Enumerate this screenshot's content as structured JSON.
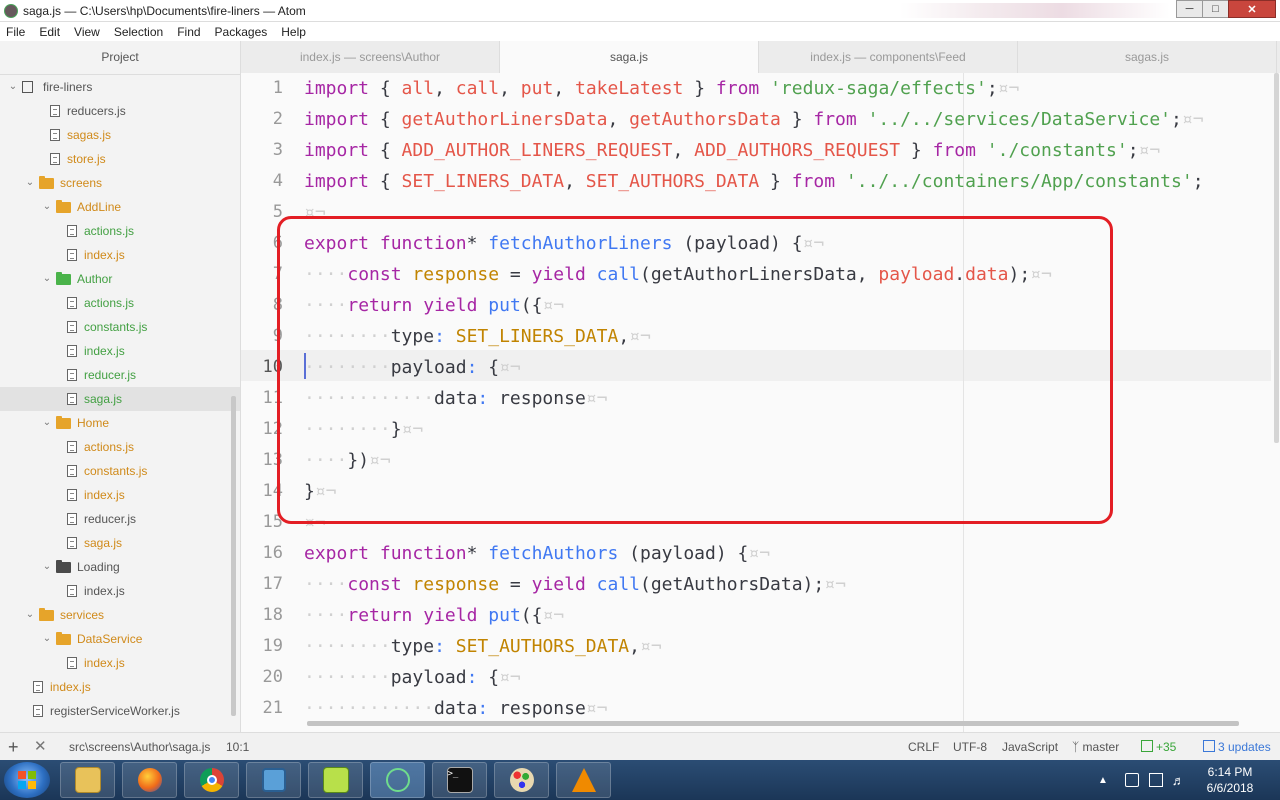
{
  "window": {
    "title": "saga.js — C:\\Users\\hp\\Documents\\fire-liners — Atom"
  },
  "menu": [
    "File",
    "Edit",
    "View",
    "Selection",
    "Find",
    "Packages",
    "Help"
  ],
  "sidebar": {
    "header": "Project",
    "tree": [
      {
        "label": "fire-liners",
        "kind": "repo",
        "depth": 0,
        "expanded": true,
        "color": "gray"
      },
      {
        "label": "reducers.js",
        "kind": "file",
        "depth": 2,
        "color": "gray"
      },
      {
        "label": "sagas.js",
        "kind": "file",
        "depth": 2,
        "color": "orange"
      },
      {
        "label": "store.js",
        "kind": "file",
        "depth": 2,
        "color": "orange"
      },
      {
        "label": "screens",
        "kind": "folder",
        "depth": 1,
        "expanded": true,
        "color": "orange"
      },
      {
        "label": "AddLine",
        "kind": "folder",
        "depth": 2,
        "expanded": true,
        "color": "orange"
      },
      {
        "label": "actions.js",
        "kind": "file",
        "depth": 3,
        "color": "green"
      },
      {
        "label": "index.js",
        "kind": "file",
        "depth": 3,
        "color": "orange"
      },
      {
        "label": "Author",
        "kind": "folder",
        "depth": 2,
        "expanded": true,
        "color": "green"
      },
      {
        "label": "actions.js",
        "kind": "file",
        "depth": 3,
        "color": "green"
      },
      {
        "label": "constants.js",
        "kind": "file",
        "depth": 3,
        "color": "green"
      },
      {
        "label": "index.js",
        "kind": "file",
        "depth": 3,
        "color": "green"
      },
      {
        "label": "reducer.js",
        "kind": "file",
        "depth": 3,
        "color": "green"
      },
      {
        "label": "saga.js",
        "kind": "file",
        "depth": 3,
        "color": "green",
        "selected": true
      },
      {
        "label": "Home",
        "kind": "folder",
        "depth": 2,
        "expanded": true,
        "color": "orange"
      },
      {
        "label": "actions.js",
        "kind": "file",
        "depth": 3,
        "color": "orange"
      },
      {
        "label": "constants.js",
        "kind": "file",
        "depth": 3,
        "color": "orange"
      },
      {
        "label": "index.js",
        "kind": "file",
        "depth": 3,
        "color": "orange"
      },
      {
        "label": "reducer.js",
        "kind": "file",
        "depth": 3,
        "color": "gray"
      },
      {
        "label": "saga.js",
        "kind": "file",
        "depth": 3,
        "color": "orange"
      },
      {
        "label": "Loading",
        "kind": "folder",
        "depth": 2,
        "expanded": true,
        "color": "gray"
      },
      {
        "label": "index.js",
        "kind": "file",
        "depth": 3,
        "color": "gray"
      },
      {
        "label": "services",
        "kind": "folder",
        "depth": 1,
        "expanded": true,
        "color": "orange"
      },
      {
        "label": "DataService",
        "kind": "folder",
        "depth": 2,
        "expanded": true,
        "color": "orange"
      },
      {
        "label": "index.js",
        "kind": "file",
        "depth": 3,
        "color": "orange"
      },
      {
        "label": "index.js",
        "kind": "file",
        "depth": 1,
        "color": "orange"
      },
      {
        "label": "registerServiceWorker.js",
        "kind": "file",
        "depth": 1,
        "color": "gray"
      }
    ]
  },
  "tabs": [
    {
      "label": "index.js — screens\\Author",
      "active": false
    },
    {
      "label": "saga.js",
      "active": true
    },
    {
      "label": "index.js — components\\Feed",
      "active": false
    },
    {
      "label": "sagas.js",
      "active": false
    }
  ],
  "editor": {
    "active_line": 10,
    "lines": [
      {
        "n": "1",
        "tokens": [
          [
            "kw",
            "import"
          ],
          [
            "pun",
            " { "
          ],
          [
            "var",
            "all"
          ],
          [
            "pun",
            ", "
          ],
          [
            "var",
            "call"
          ],
          [
            "pun",
            ", "
          ],
          [
            "var",
            "put"
          ],
          [
            "pun",
            ", "
          ],
          [
            "var",
            "takeLatest"
          ],
          [
            "pun",
            " } "
          ],
          [
            "kw",
            "from"
          ],
          [
            "pun",
            " "
          ],
          [
            "str",
            "'redux-saga/effects'"
          ],
          [
            "pun",
            ";"
          ],
          [
            "inv",
            "¤¬"
          ]
        ]
      },
      {
        "n": "2",
        "tokens": [
          [
            "kw",
            "import"
          ],
          [
            "pun",
            " { "
          ],
          [
            "var",
            "getAuthorLinersData"
          ],
          [
            "pun",
            ", "
          ],
          [
            "var",
            "getAuthorsData"
          ],
          [
            "pun",
            " } "
          ],
          [
            "kw",
            "from"
          ],
          [
            "pun",
            " "
          ],
          [
            "str",
            "'../../services/DataService'"
          ],
          [
            "pun",
            ";"
          ],
          [
            "inv",
            "¤¬"
          ]
        ]
      },
      {
        "n": "3",
        "tokens": [
          [
            "kw",
            "import"
          ],
          [
            "pun",
            " { "
          ],
          [
            "var",
            "ADD_AUTHOR_LINERS_REQUEST"
          ],
          [
            "pun",
            ", "
          ],
          [
            "var",
            "ADD_AUTHORS_REQUEST"
          ],
          [
            "pun",
            " } "
          ],
          [
            "kw",
            "from"
          ],
          [
            "pun",
            " "
          ],
          [
            "str",
            "'./constants'"
          ],
          [
            "pun",
            ";"
          ],
          [
            "inv",
            "¤¬"
          ]
        ]
      },
      {
        "n": "4",
        "tokens": [
          [
            "kw",
            "import"
          ],
          [
            "pun",
            " { "
          ],
          [
            "var",
            "SET_LINERS_DATA"
          ],
          [
            "pun",
            ", "
          ],
          [
            "var",
            "SET_AUTHORS_DATA"
          ],
          [
            "pun",
            " } "
          ],
          [
            "kw",
            "from"
          ],
          [
            "pun",
            " "
          ],
          [
            "str",
            "'../../containers/App/constants'"
          ],
          [
            "pun",
            ";"
          ]
        ]
      },
      {
        "n": "5",
        "tokens": [
          [
            "inv",
            "¤¬"
          ]
        ]
      },
      {
        "n": "6",
        "tokens": [
          [
            "kw",
            "export"
          ],
          [
            "pun",
            " "
          ],
          [
            "kw",
            "function"
          ],
          [
            "pun",
            "* "
          ],
          [
            "fn",
            "fetchAuthorLiners"
          ],
          [
            "pun",
            " (payload) {"
          ],
          [
            "inv",
            "¤¬"
          ]
        ]
      },
      {
        "n": "7",
        "tokens": [
          [
            "inv",
            "····"
          ],
          [
            "kw",
            "const"
          ],
          [
            "pun",
            " "
          ],
          [
            "cst",
            "response"
          ],
          [
            "pun",
            " = "
          ],
          [
            "kw",
            "yield"
          ],
          [
            "pun",
            " "
          ],
          [
            "fn",
            "call"
          ],
          [
            "pun",
            "(getAuthorLinersData, "
          ],
          [
            "var",
            "payload"
          ],
          [
            "pun",
            "."
          ],
          [
            "var",
            "data"
          ],
          [
            "pun",
            ");"
          ],
          [
            "inv",
            "¤¬"
          ]
        ]
      },
      {
        "n": "8",
        "tokens": [
          [
            "inv",
            "····"
          ],
          [
            "kw",
            "return"
          ],
          [
            "pun",
            " "
          ],
          [
            "kw",
            "yield"
          ],
          [
            "pun",
            " "
          ],
          [
            "fn",
            "put"
          ],
          [
            "pun",
            "({"
          ],
          [
            "inv",
            "¤¬"
          ]
        ]
      },
      {
        "n": "9",
        "tokens": [
          [
            "inv",
            "········"
          ],
          [
            "pun",
            "type"
          ],
          [
            "fn",
            ":"
          ],
          [
            "pun",
            " "
          ],
          [
            "cst",
            "SET_LINERS_DATA"
          ],
          [
            "pun",
            ","
          ],
          [
            "inv",
            "¤¬"
          ]
        ]
      },
      {
        "n": "10",
        "tokens": [
          [
            "inv",
            "········"
          ],
          [
            "pun",
            "payload"
          ],
          [
            "fn",
            ":"
          ],
          [
            "pun",
            " {"
          ],
          [
            "inv",
            "¤¬"
          ]
        ]
      },
      {
        "n": "11",
        "tokens": [
          [
            "inv",
            "············"
          ],
          [
            "pun",
            "data"
          ],
          [
            "fn",
            ":"
          ],
          [
            "pun",
            " response"
          ],
          [
            "inv",
            "¤¬"
          ]
        ]
      },
      {
        "n": "12",
        "tokens": [
          [
            "inv",
            "········"
          ],
          [
            "pun",
            "}"
          ],
          [
            "inv",
            "¤¬"
          ]
        ]
      },
      {
        "n": "13",
        "tokens": [
          [
            "inv",
            "····"
          ],
          [
            "pun",
            "})"
          ],
          [
            "inv",
            "¤¬"
          ]
        ]
      },
      {
        "n": "14",
        "tokens": [
          [
            "pun",
            "}"
          ],
          [
            "inv",
            "¤¬"
          ]
        ]
      },
      {
        "n": "15",
        "tokens": [
          [
            "inv",
            "¤¬"
          ]
        ]
      },
      {
        "n": "16",
        "tokens": [
          [
            "kw",
            "export"
          ],
          [
            "pun",
            " "
          ],
          [
            "kw",
            "function"
          ],
          [
            "pun",
            "* "
          ],
          [
            "fn",
            "fetchAuthors"
          ],
          [
            "pun",
            " (payload) {"
          ],
          [
            "inv",
            "¤¬"
          ]
        ]
      },
      {
        "n": "17",
        "tokens": [
          [
            "inv",
            "····"
          ],
          [
            "kw",
            "const"
          ],
          [
            "pun",
            " "
          ],
          [
            "cst",
            "response"
          ],
          [
            "pun",
            " = "
          ],
          [
            "kw",
            "yield"
          ],
          [
            "pun",
            " "
          ],
          [
            "fn",
            "call"
          ],
          [
            "pun",
            "(getAuthorsData);"
          ],
          [
            "inv",
            "¤¬"
          ]
        ]
      },
      {
        "n": "18",
        "tokens": [
          [
            "inv",
            "····"
          ],
          [
            "kw",
            "return"
          ],
          [
            "pun",
            " "
          ],
          [
            "kw",
            "yield"
          ],
          [
            "pun",
            " "
          ],
          [
            "fn",
            "put"
          ],
          [
            "pun",
            "({"
          ],
          [
            "inv",
            "¤¬"
          ]
        ]
      },
      {
        "n": "19",
        "tokens": [
          [
            "inv",
            "········"
          ],
          [
            "pun",
            "type"
          ],
          [
            "fn",
            ":"
          ],
          [
            "pun",
            " "
          ],
          [
            "cst",
            "SET_AUTHORS_DATA"
          ],
          [
            "pun",
            ","
          ],
          [
            "inv",
            "¤¬"
          ]
        ]
      },
      {
        "n": "20",
        "tokens": [
          [
            "inv",
            "········"
          ],
          [
            "pun",
            "payload"
          ],
          [
            "fn",
            ":"
          ],
          [
            "pun",
            " {"
          ],
          [
            "inv",
            "¤¬"
          ]
        ]
      },
      {
        "n": "21",
        "tokens": [
          [
            "inv",
            "············"
          ],
          [
            "pun",
            "data"
          ],
          [
            "fn",
            ":"
          ],
          [
            "pun",
            " response"
          ],
          [
            "inv",
            "¤¬"
          ]
        ]
      }
    ]
  },
  "status": {
    "add_icon": "plus-icon",
    "close_icon": "x-icon",
    "path": "src\\screens\\Author\\saga.js",
    "cursor": "10:1",
    "line_ending": "CRLF",
    "encoding": "UTF-8",
    "grammar": "JavaScript",
    "branch": "master",
    "git_added": "+35",
    "updates": "3 updates"
  },
  "taskbar": {
    "apps": [
      "file-explorer",
      "firefox",
      "chrome",
      "network-app",
      "notepad-plus-plus",
      "atom",
      "command-prompt",
      "paint",
      "vlc"
    ],
    "active_app": "atom",
    "time": "6:14 PM",
    "date": "6/6/2018"
  }
}
